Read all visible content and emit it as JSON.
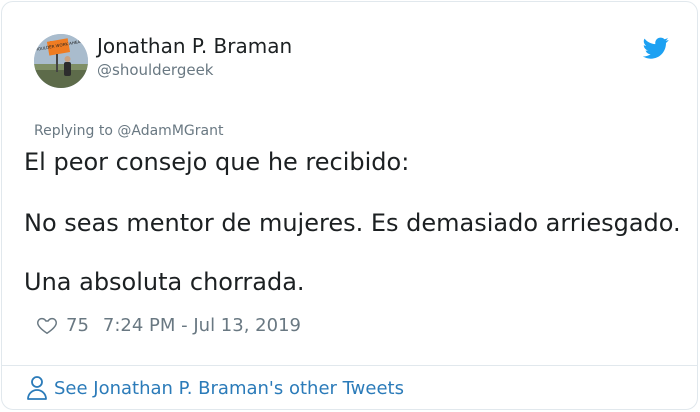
{
  "tweet": {
    "author": {
      "display_name": "Jonathan P. Braman",
      "handle": "@shouldergeek",
      "avatar_sign_text": "SHOULDER WORK AHEAD"
    },
    "reply_context": "Replying to @AdamMGrant",
    "body_lines": [
      "El peor consejo que he recibido:",
      "No seas mentor de mujeres. Es demasiado arriesgado.",
      "Una absoluta chorrada."
    ],
    "like_count": "75",
    "timestamp": "7:24 PM - Jul 13, 2019"
  },
  "footer": {
    "link_text": "See Jonathan P. Braman's other Tweets"
  },
  "colors": {
    "text": "#1c2022",
    "muted": "#697882",
    "link": "#2b7bb9",
    "twitter_blue": "#1da1f2",
    "border": "#e1e8ed"
  },
  "icons": {
    "brand": "twitter-bird-icon",
    "like": "heart-icon",
    "profile": "person-icon"
  }
}
